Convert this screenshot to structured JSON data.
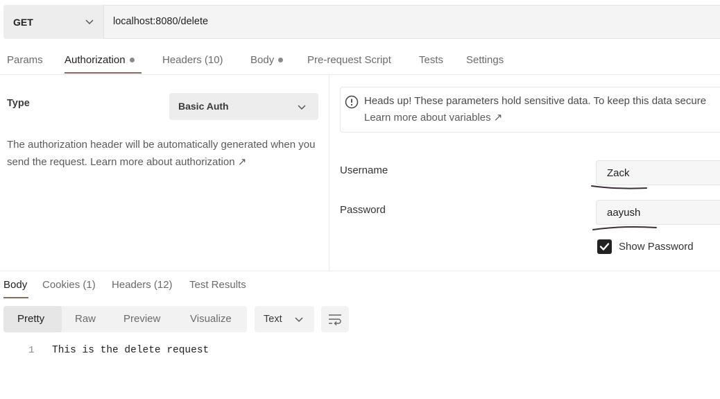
{
  "request": {
    "method": "GET",
    "url": "localhost:8080/delete"
  },
  "request_tabs": [
    {
      "label": "Params"
    },
    {
      "label": "Authorization"
    },
    {
      "label": "Headers (10)"
    },
    {
      "label": "Body"
    },
    {
      "label": "Pre-request Script"
    },
    {
      "label": "Tests"
    },
    {
      "label": "Settings"
    }
  ],
  "auth": {
    "type_label": "Type",
    "type_value": "Basic Auth",
    "description": "The authorization header will be automatically generated when you send the request.",
    "learn_more": "Learn more about authorization ↗"
  },
  "notice": {
    "text": "Heads up! These parameters hold sensitive data. To keep this data secure",
    "link": "Learn more about variables ↗"
  },
  "credentials": {
    "username_label": "Username",
    "username_value": "Zack",
    "password_label": "Password",
    "password_value": "aayush",
    "show_password_label": "Show Password",
    "show_password_checked": true
  },
  "response_tabs": [
    {
      "label": "Body"
    },
    {
      "label": "Cookies (1)"
    },
    {
      "label": "Headers (12)"
    },
    {
      "label": "Test Results"
    }
  ],
  "view_modes": [
    {
      "label": "Pretty"
    },
    {
      "label": "Raw"
    },
    {
      "label": "Preview"
    },
    {
      "label": "Visualize"
    }
  ],
  "format": "Text",
  "response_body": {
    "line_number": "1",
    "text": "This is the delete request"
  },
  "colors": {
    "accent_underline": "#8a6a5a",
    "checkbox": "#222222"
  }
}
